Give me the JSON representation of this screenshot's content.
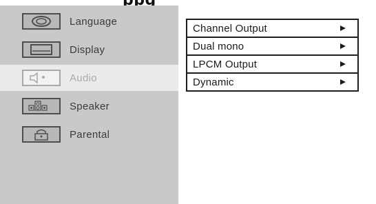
{
  "header": {
    "title_fragment": "ppg"
  },
  "sidebar": {
    "selected": "Audio",
    "items": [
      {
        "label": "Language",
        "icon": "language-icon"
      },
      {
        "label": "Display",
        "icon": "display-icon"
      },
      {
        "label": "Audio",
        "icon": "audio-icon"
      },
      {
        "label": "Speaker",
        "icon": "speaker-icon"
      },
      {
        "label": "Parental",
        "icon": "parental-lock-icon"
      }
    ]
  },
  "submenu": {
    "items": [
      {
        "label": "Channel Output",
        "arrow": "right-arrow-icon"
      },
      {
        "label": "Dual mono",
        "arrow": "right-arrow-icon"
      },
      {
        "label": "LPCM Output",
        "arrow": "right-arrow-icon"
      },
      {
        "label": "Dynamic",
        "arrow": "right-arrow-icon"
      }
    ]
  },
  "colors": {
    "sidebar_bg": "#c9c9c9",
    "selected_bg": "#ebebeb",
    "border": "#1e1e1e",
    "text": "#3a3a3a",
    "selected_text": "#a9a9a9"
  }
}
